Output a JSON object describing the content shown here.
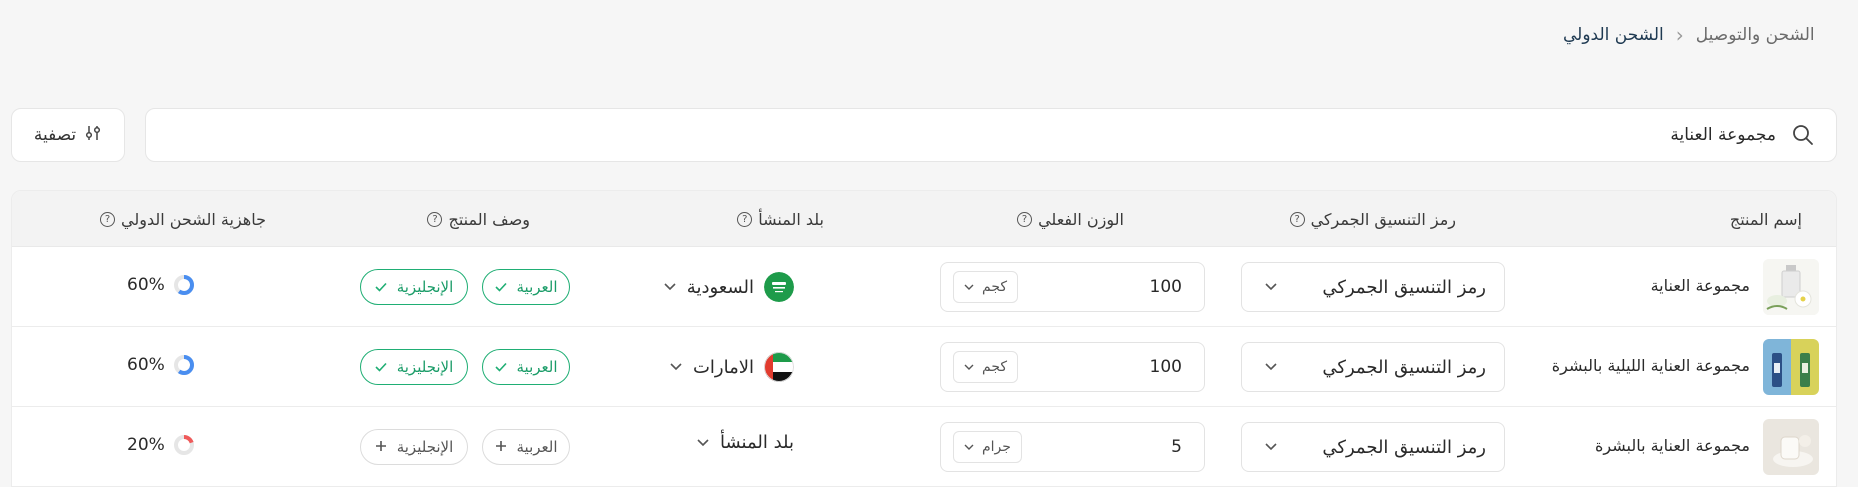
{
  "breadcrumb": {
    "parent": "الشحن والتوصيل",
    "current": "الشحن الدولي"
  },
  "search": {
    "value": "مجموعة العناية"
  },
  "filter": {
    "label": "تصفية"
  },
  "table": {
    "headers": {
      "product_name": "إسم المنتج",
      "hs_code": "رمز التنسيق الجمركي",
      "actual_weight": "الوزن الفعلي",
      "origin_country": "بلد المنشأ",
      "product_description": "وصف المنتج",
      "shipping_readiness": "جاهزية الشحن الدولي"
    },
    "rows": [
      {
        "name": "مجموعة العناية",
        "hs_code": "رمز التنسيق الجمركي",
        "weight": "100",
        "unit": "كجم",
        "country": "السعودية",
        "desc_arabic": "العربية",
        "desc_english": "الإنجليزية",
        "desc_status": "complete",
        "readiness": "60%",
        "readiness_fraction": 0.6
      },
      {
        "name": "مجموعة العناية الليلية بالبشرة",
        "hs_code": "رمز التنسيق الجمركي",
        "weight": "100",
        "unit": "كجم",
        "country": "الامارات",
        "desc_arabic": "العربية",
        "desc_english": "الإنجليزية",
        "desc_status": "complete",
        "readiness": "60%",
        "readiness_fraction": 0.6
      },
      {
        "name": "مجموعة العناية بالبشرة",
        "hs_code": "رمز التنسيق الجمركي",
        "weight": "5",
        "unit": "جرام",
        "country": "بلد المنشأ",
        "desc_arabic": "العربية",
        "desc_english": "الإنجليزية",
        "desc_status": "missing",
        "readiness": "20%",
        "readiness_fraction": 0.2
      }
    ]
  },
  "colors": {
    "accent_blue": "#4a8ef0",
    "success_green": "#1fae74",
    "warning_red": "#ef5a5a"
  }
}
